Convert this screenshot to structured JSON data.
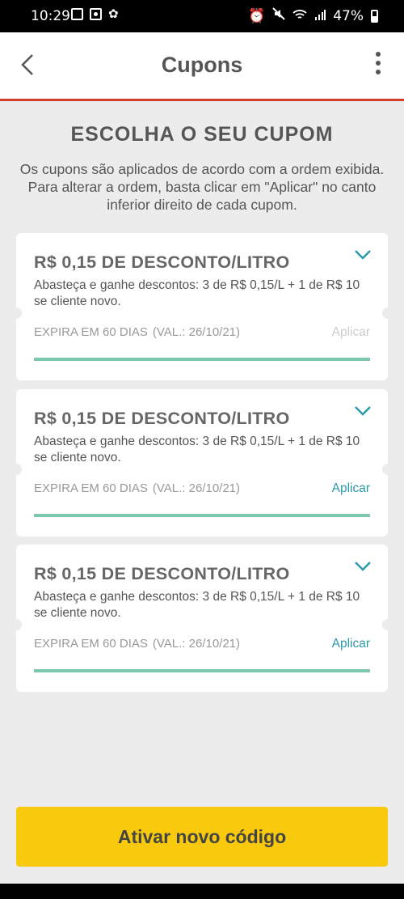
{
  "status_bar": {
    "time": "10:29",
    "battery": "47%",
    "battery_level": 0.47
  },
  "app_bar": {
    "title": "Cupons"
  },
  "page": {
    "heading": "ESCOLHA O SEU CUPOM",
    "subtext": "Os cupons são aplicados de acordo com a ordem exibida. Para alterar a ordem, basta clicar em \"Aplicar\" no canto inferior direito de cada cupom."
  },
  "coupons": [
    {
      "title": "R$ 0,15 DE DESCONTO/LITRO",
      "description": "Abasteça e ganhe descontos: 3 de R$ 0,15/L + 1 de R$ 10 se cliente novo.",
      "expiry": "EXPIRA EM 60 DIAS",
      "validity": "(VAL.: 26/10/21)",
      "apply_label": "Aplicar",
      "apply_enabled": false,
      "progress": 1.0
    },
    {
      "title": "R$ 0,15 DE DESCONTO/LITRO",
      "description": "Abasteça e ganhe descontos: 3 de R$ 0,15/L + 1 de R$ 10 se cliente novo.",
      "expiry": "EXPIRA EM 60 DIAS",
      "validity": "(VAL.: 26/10/21)",
      "apply_label": "Aplicar",
      "apply_enabled": true,
      "progress": 1.0
    },
    {
      "title": "R$ 0,15 DE DESCONTO/LITRO",
      "description": "Abasteça e ganhe descontos: 3 de R$ 0,15/L + 1 de R$ 10 se cliente novo.",
      "expiry": "EXPIRA EM 60 DIAS",
      "validity": "(VAL.: 26/10/21)",
      "apply_label": "Aplicar",
      "apply_enabled": true,
      "progress": 1.0
    }
  ],
  "cta": {
    "label": "Ativar novo código"
  },
  "colors": {
    "accent_line": "#d43f2a",
    "cta_yellow": "#f8c90c",
    "apply_teal": "#2a9aa8",
    "progress_green": "#7ec8b0"
  },
  "icons": {
    "back": "chevron-left-icon",
    "menu": "more-vertical-icon",
    "expand": "chevron-down-icon"
  }
}
